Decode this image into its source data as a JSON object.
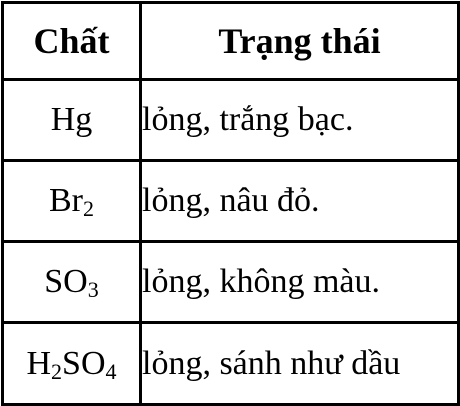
{
  "table": {
    "headers": {
      "substance": "Chất",
      "state": "Trạng thái"
    },
    "rows": [
      {
        "substance": [
          "Hg"
        ],
        "state": "lỏng, trắng bạc."
      },
      {
        "substance": [
          "Br",
          "2"
        ],
        "state": "lỏng, nâu đỏ."
      },
      {
        "substance": [
          "SO",
          "3"
        ],
        "state": "lỏng, không màu."
      },
      {
        "substance": [
          "H",
          "2",
          "SO",
          "4"
        ],
        "state": "lỏng, sánh như dầu"
      }
    ]
  }
}
